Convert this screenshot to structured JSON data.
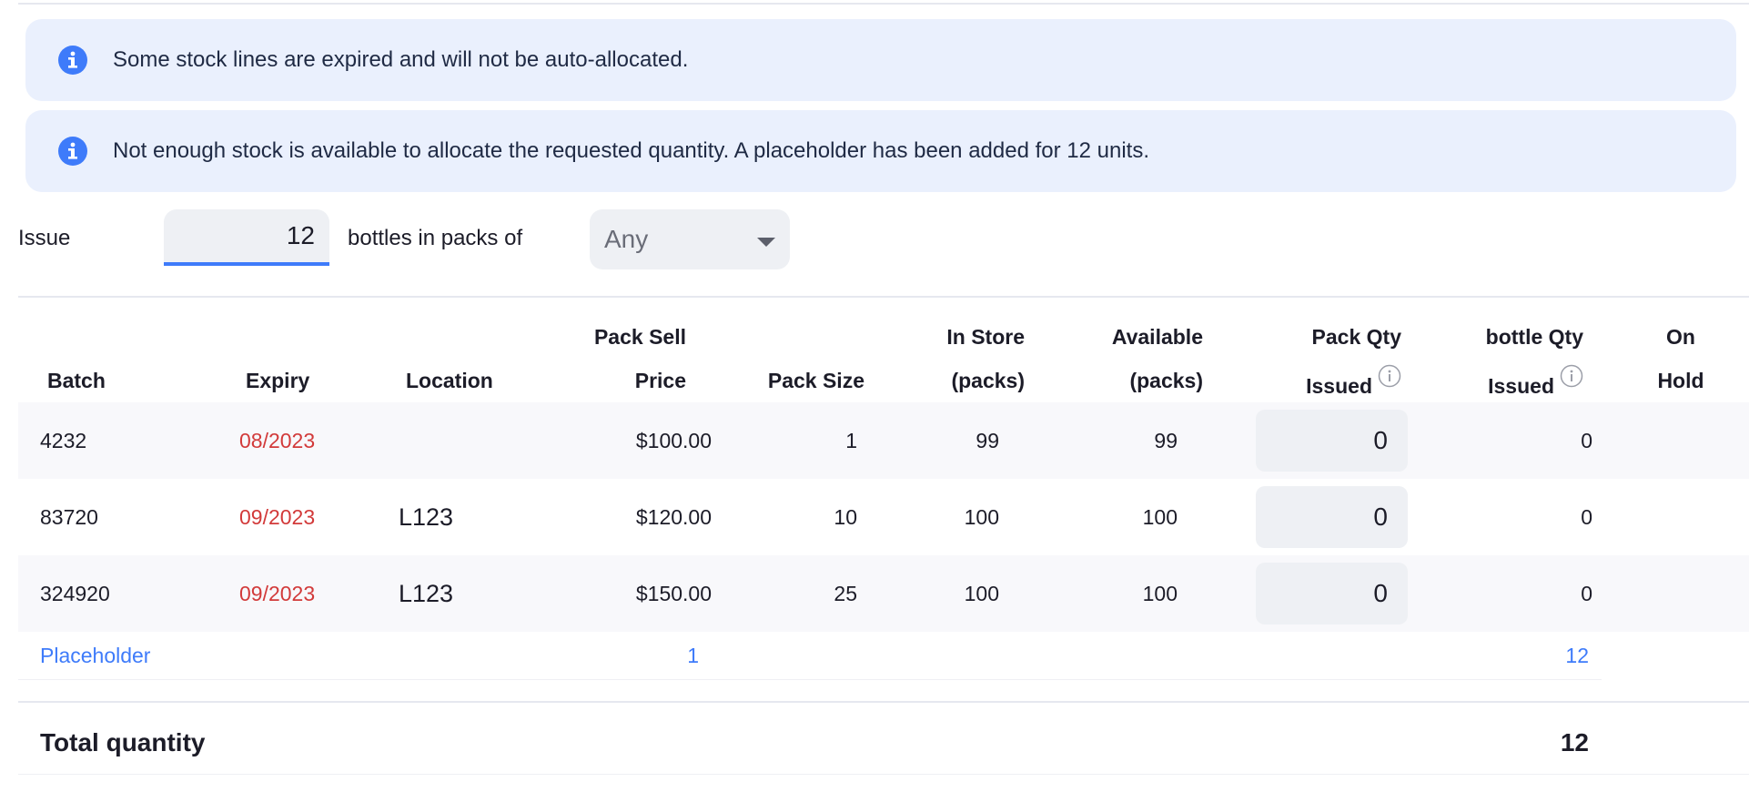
{
  "alerts": [
    {
      "message": "Some stock lines are expired and will not be auto-allocated."
    },
    {
      "message": "Not enough stock is available to allocate the requested quantity. A placeholder has been added for 12 units."
    }
  ],
  "issue": {
    "label": "Issue",
    "value": "12",
    "unit_label": "bottles in packs of",
    "pack_select": "Any"
  },
  "table": {
    "headers": {
      "batch": [
        "Batch"
      ],
      "expiry": [
        "Expiry"
      ],
      "location": [
        "Location"
      ],
      "pack_sell_price": [
        "Pack Sell",
        "Price"
      ],
      "pack_size": [
        "Pack Size"
      ],
      "in_store": [
        "In Store",
        "(packs)"
      ],
      "available": [
        "Available",
        "(packs)"
      ],
      "pack_qty_issued": [
        "Pack Qty",
        "Issued"
      ],
      "bottle_qty_issued": [
        "bottle Qty",
        "Issued"
      ],
      "on_hold": [
        "On",
        "Hold"
      ]
    },
    "rows": [
      {
        "batch": "4232",
        "expiry": "08/2023",
        "location": "",
        "price": "$100.00",
        "pack_size": "1",
        "in_store": "99",
        "available": "99",
        "pack_qty": "0",
        "bottle_qty": "0"
      },
      {
        "batch": "83720",
        "expiry": "09/2023",
        "location": "L123",
        "price": "$120.00",
        "pack_size": "10",
        "in_store": "100",
        "available": "100",
        "pack_qty": "0",
        "bottle_qty": "0"
      },
      {
        "batch": "324920",
        "expiry": "09/2023",
        "location": "L123",
        "price": "$150.00",
        "pack_size": "25",
        "in_store": "100",
        "available": "100",
        "pack_qty": "0",
        "bottle_qty": "0"
      }
    ],
    "placeholder": {
      "label": "Placeholder",
      "pack_size": "1",
      "bottle_qty": "12"
    }
  },
  "total": {
    "label": "Total quantity",
    "value": "12"
  },
  "colors": {
    "accent": "#3e7bfa",
    "expired": "#d23a3a",
    "alert_bg": "#eaf0fd"
  }
}
